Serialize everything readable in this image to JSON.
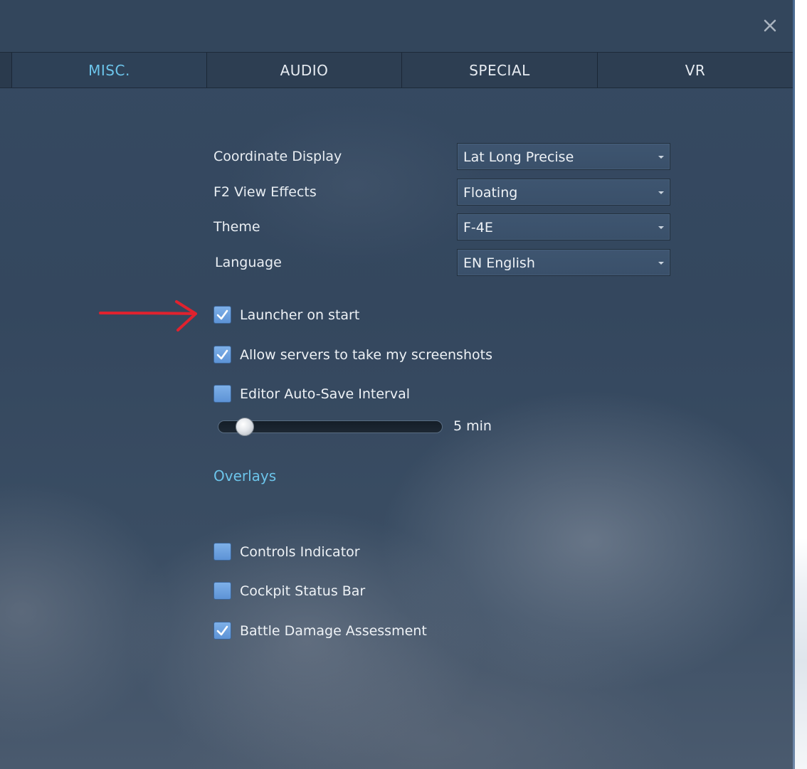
{
  "window": {
    "close_label": "×"
  },
  "tabs": [
    {
      "label": "",
      "active": false
    },
    {
      "label": "MISC.",
      "active": true
    },
    {
      "label": "AUDIO",
      "active": false
    },
    {
      "label": "SPECIAL",
      "active": false
    },
    {
      "label": "VR",
      "active": false
    }
  ],
  "settings": [
    {
      "label": "Coordinate Display",
      "value": "Lat Long Precise"
    },
    {
      "label": "F2 View Effects",
      "value": "Floating"
    },
    {
      "label": "Theme",
      "value": "F-4E"
    },
    {
      "label": "Language",
      "value": "EN English"
    }
  ],
  "options": [
    {
      "label": "Launcher on start",
      "checked": true
    },
    {
      "label": "Allow servers to take my screenshots",
      "checked": true
    },
    {
      "label": "Editor Auto-Save Interval",
      "checked": false
    }
  ],
  "autosave_slider": {
    "value_label": "5 min",
    "fraction": 0.04
  },
  "overlays": {
    "heading": "Overlays",
    "items": [
      {
        "label": "Controls Indicator",
        "checked": false
      },
      {
        "label": "Cockpit Status Bar",
        "checked": false
      },
      {
        "label": "Battle Damage Assessment",
        "checked": true
      }
    ]
  },
  "colors": {
    "accent": "#6cc4ea",
    "checkbox": "#6a9fe0",
    "annotation_arrow": "#e0222e"
  },
  "icons": {
    "close": "close-icon",
    "dropdown": "chevron-down-icon",
    "check": "checkmark-icon",
    "annotation": "red-arrow-annotation"
  }
}
